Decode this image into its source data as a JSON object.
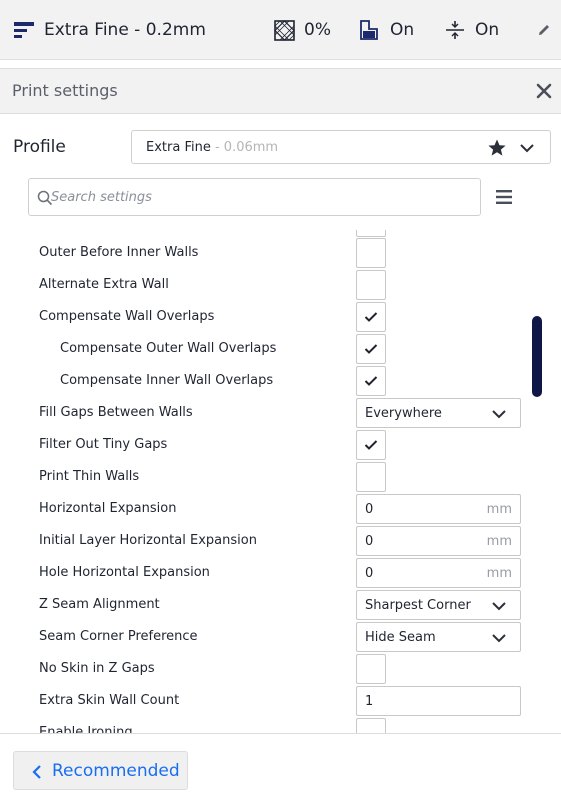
{
  "topbar": {
    "profile_icon": "printer-profile-icon",
    "profile_name": "Extra Fine - 0.2mm",
    "infill_icon": "infill-icon",
    "infill_value": "0%",
    "support_icon": "support-icon",
    "support_value": "On",
    "adhesion_icon": "adhesion-icon",
    "adhesion_value": "On",
    "edit_icon": "pencil-icon"
  },
  "panel": {
    "title": "Print settings",
    "close_icon": "close-icon"
  },
  "profile": {
    "label": "Profile",
    "name": "Extra Fine",
    "sub": " - 0.06mm",
    "star_icon": "star-icon",
    "chevron_icon": "chevron-down-icon"
  },
  "search": {
    "placeholder": "Search settings",
    "icon": "search-icon",
    "menu_icon": "hamburger-menu-icon"
  },
  "settings": [
    {
      "label": "Outer Before Inner Walls",
      "type": "checkbox",
      "checked": false
    },
    {
      "label": "Alternate Extra Wall",
      "type": "checkbox",
      "checked": false
    },
    {
      "label": "Compensate Wall Overlaps",
      "type": "checkbox",
      "checked": true
    },
    {
      "label": "Compensate Outer Wall Overlaps",
      "type": "checkbox",
      "checked": true
    },
    {
      "label": "Compensate Inner Wall Overlaps",
      "type": "checkbox",
      "checked": true
    },
    {
      "label": "Fill Gaps Between Walls",
      "type": "dropdown",
      "value": "Everywhere"
    },
    {
      "label": "Filter Out Tiny Gaps",
      "type": "checkbox",
      "checked": true
    },
    {
      "label": "Print Thin Walls",
      "type": "checkbox",
      "checked": false
    },
    {
      "label": "Horizontal Expansion",
      "type": "number",
      "value": "0",
      "unit": "mm"
    },
    {
      "label": "Initial Layer Horizontal Expansion",
      "type": "number",
      "value": "0",
      "unit": "mm"
    },
    {
      "label": "Hole Horizontal Expansion",
      "type": "number",
      "value": "0",
      "unit": "mm"
    },
    {
      "label": "Z Seam Alignment",
      "type": "dropdown",
      "value": "Sharpest Corner"
    },
    {
      "label": "Seam Corner Preference",
      "type": "dropdown",
      "value": "Hide Seam"
    },
    {
      "label": "No Skin in Z Gaps",
      "type": "checkbox",
      "checked": false
    },
    {
      "label": "Extra Skin Wall Count",
      "type": "number",
      "value": "1",
      "unit": ""
    },
    {
      "label": "Enable Ironing",
      "type": "checkbox",
      "checked": false
    }
  ],
  "footer": {
    "recommended_label": "Recommended",
    "back_icon": "chevron-left-icon"
  },
  "colors": {
    "accent": "#196ef0",
    "scrollbar": "#0e1746",
    "panel_bg": "#f2f2f3"
  }
}
